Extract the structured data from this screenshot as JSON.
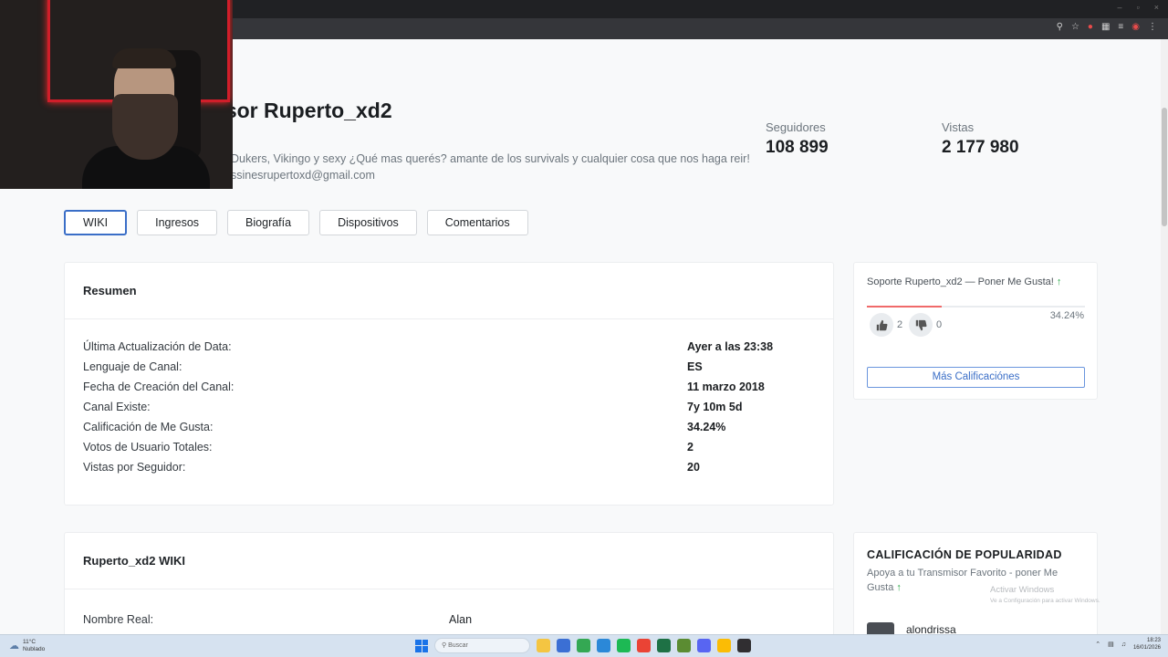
{
  "window": {
    "minimize": "–",
    "maximize": "▫",
    "close": "×"
  },
  "browser_toolbar": {
    "icons": [
      "zoom-icon",
      "bookmark-star-icon",
      "extension-icon",
      "puzzle-icon",
      "playlist-icon",
      "profile-icon",
      "menu-icon"
    ]
  },
  "channel": {
    "title_partial": "misor Ruperto_xd2",
    "description_partial": "Dukers, Vikingo y sexy ¿Qué mas querés? amante de los survivals y cualquier cosa que nos haga reir!",
    "email_partial": "ssinesrupertoxd@gmail.com"
  },
  "stats": {
    "followers": {
      "label": "Seguidores",
      "value": "108 899"
    },
    "views": {
      "label": "Vistas",
      "value": "2 177 980"
    }
  },
  "tabs": [
    {
      "label": "WIKI",
      "active": true
    },
    {
      "label": "Ingresos"
    },
    {
      "label": "Biografía"
    },
    {
      "label": "Dispositivos"
    },
    {
      "label": "Comentarios"
    }
  ],
  "summary": {
    "title": "Resumen",
    "rows": [
      {
        "key": "Última Actualización de Data:",
        "value": "Ayer a las 23:38"
      },
      {
        "key": "Lenguaje de Canal:",
        "value": "ES"
      },
      {
        "key": "Fecha de Creación del Canal:",
        "value": "11 marzo 2018"
      },
      {
        "key": "Canal Existe:",
        "value": "7y 10m 5d"
      },
      {
        "key": "Calificación de Me Gusta:",
        "value": "34.24%"
      },
      {
        "key": "Votos de Usuario Totales:",
        "value": "2"
      },
      {
        "key": "Vistas por Seguidor:",
        "value": "20"
      }
    ]
  },
  "support": {
    "title": "Soporte Ruperto_xd2 — Poner Me Gusta!",
    "arrow": "↑",
    "percent_text": "34.24%",
    "like_fraction": 0.3424,
    "likes": "2",
    "dislikes": "0",
    "more_button": "Más Calificaciónes"
  },
  "wiki": {
    "title": "Ruperto_xd2 WIKI",
    "rows": [
      {
        "key": "Nombre Real:",
        "value": "Alan"
      }
    ]
  },
  "popularity": {
    "title": "CALIFICACIÓN DE POPULARIDAD",
    "subtitle": "Apoya a tu Transmisor Favorito - poner Me Gusta",
    "arrow": "↑",
    "first_user": "alondrissa"
  },
  "watermark": {
    "line1": "Activar Windows",
    "line2": "Ve a Configuración para activar Windows."
  },
  "taskbar": {
    "weather_temp": "11°C",
    "weather_desc": "Nublado",
    "search_placeholder": "Buscar",
    "time": "18:23",
    "date": "16/01/2026",
    "apps": [
      {
        "name": "file-explorer-icon",
        "color": "#f4c542"
      },
      {
        "name": "store-icon",
        "color": "#3b6fd4"
      },
      {
        "name": "chrome-icon",
        "color": "#34a853"
      },
      {
        "name": "edge-icon",
        "color": "#2b88d8"
      },
      {
        "name": "spotify-icon",
        "color": "#1db954"
      },
      {
        "name": "chrome-alt-icon",
        "color": "#ea4335"
      },
      {
        "name": "excel-icon",
        "color": "#1e7145"
      },
      {
        "name": "minecraft-icon",
        "color": "#5b8c32"
      },
      {
        "name": "discord-icon",
        "color": "#5865f2"
      },
      {
        "name": "chrome-active-icon",
        "color": "#fbbc05"
      },
      {
        "name": "obs-icon",
        "color": "#302e31"
      }
    ]
  },
  "colors": {
    "accent": "#3a6ec7",
    "like_bar": "#f06a6a",
    "positive": "#28a745"
  }
}
